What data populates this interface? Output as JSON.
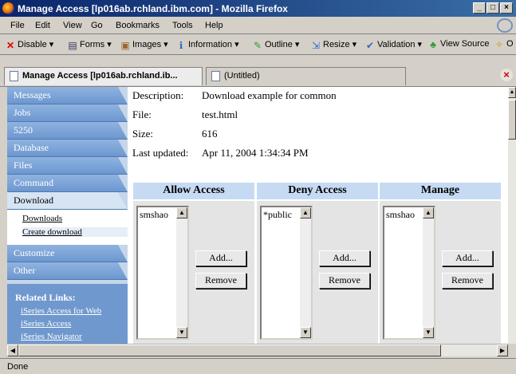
{
  "window": {
    "title": "Manage Access [lp016ab.rchland.ibm.com] - Mozilla Firefox"
  },
  "menu": [
    "File",
    "Edit",
    "View",
    "Go",
    "Bookmarks",
    "Tools",
    "Help"
  ],
  "toolbar": [
    "Disable ▾",
    "Forms ▾",
    "Images ▾",
    "Information ▾",
    "Outline ▾",
    "Resize ▾",
    "Validation ▾",
    "View Source",
    "O"
  ],
  "tabs": [
    "Manage Access [lp016ab.rchland.ib...",
    "(Untitled)"
  ],
  "sidebar": {
    "nav": [
      "Messages",
      "Jobs",
      "5250",
      "Database",
      "Files",
      "Command",
      "Download",
      "Customize",
      "Other"
    ],
    "sub": [
      "Downloads",
      "Create download"
    ],
    "related_heading": "Related Links:",
    "related": [
      "iSeries Access for Web",
      "iSeries Access",
      "iSeries Navigator"
    ]
  },
  "details": [
    {
      "label": "Description:",
      "value": "Download example for common"
    },
    {
      "label": "File:",
      "value": "test.html"
    },
    {
      "label": "Size:",
      "value": "616"
    },
    {
      "label": "Last updated:",
      "value": "Apr 11, 2004 1:34:34 PM"
    }
  ],
  "columns": [
    {
      "title": "Allow Access",
      "entry": "smshao"
    },
    {
      "title": "Deny Access",
      "entry": "*public"
    },
    {
      "title": "Manage",
      "entry": "smshao"
    }
  ],
  "buttons": {
    "add": "Add...",
    "remove": "Remove"
  },
  "status": "Done"
}
